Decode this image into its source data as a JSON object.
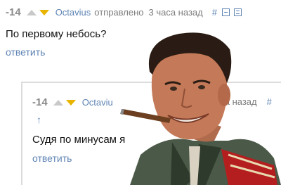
{
  "comment1": {
    "score": "-14",
    "author": "Octavius",
    "sent": "отправлено",
    "time": "3 часа назад",
    "hash": "#",
    "text": "По первому небось?",
    "reply": "ответить"
  },
  "comment2": {
    "score": "-14",
    "author_visible": "Octaviu",
    "time_visible": "аса назад",
    "hash": "#",
    "up_link": "↑",
    "text_visible": "Судя по минусам я",
    "reply": "ответить"
  },
  "colors": {
    "link": "#5f85b5",
    "score": "#8a8a8a",
    "downvote": "#e8b400"
  },
  "icons": [
    "upvote-arrow-icon",
    "downvote-arrow-icon",
    "minus-box-icon",
    "collapse-box-icon",
    "up-arrow-icon"
  ]
}
